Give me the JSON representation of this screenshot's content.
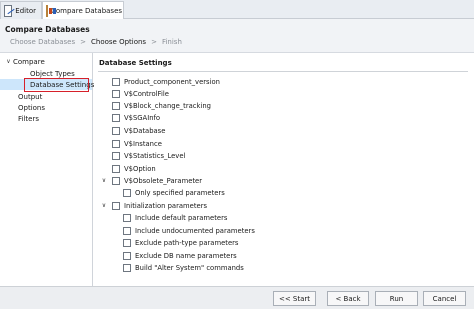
{
  "tabs": [
    {
      "label": "Editor",
      "icon": "editor-icon"
    },
    {
      "label": "Compare Databases",
      "icon": "compare-databases-icon"
    }
  ],
  "header": {
    "title": "Compare Databases",
    "breadcrumb": {
      "step1": "Choose Databases",
      "sep1": ">",
      "step2": "Choose Options",
      "sep2": ">",
      "step3": "Finish"
    }
  },
  "tree": {
    "compare": "Compare",
    "object_types": "Object Types",
    "database_settings": "Database Settings",
    "output": "Output",
    "options": "Options",
    "filters": "Filters",
    "selected": "Database Settings"
  },
  "section": {
    "title": "Database Settings"
  },
  "settings": [
    {
      "label": "Product_component_version",
      "checked": false
    },
    {
      "label": "V$ControlFile",
      "checked": false
    },
    {
      "label": "V$Block_change_tracking",
      "checked": false
    },
    {
      "label": "V$SGAInfo",
      "checked": false
    },
    {
      "label": "V$Database",
      "checked": false
    },
    {
      "label": "V$Instance",
      "checked": false
    },
    {
      "label": "V$Statistics_Level",
      "checked": false
    },
    {
      "label": "V$Option",
      "checked": false
    },
    {
      "label": "V$Obsolete_Parameter",
      "checked": false,
      "expanded": true
    },
    {
      "label": "Only specified parameters",
      "checked": false
    },
    {
      "label": "Initialization parameters",
      "checked": false,
      "expanded": true
    },
    {
      "label": "Include default parameters",
      "checked": false
    },
    {
      "label": "Include undocumented parameters",
      "checked": false
    },
    {
      "label": "Exclude path-type parameters",
      "checked": false
    },
    {
      "label": "Exclude DB name parameters",
      "checked": false
    },
    {
      "label": "Build \"Alter System\" commands",
      "checked": false
    }
  ],
  "footer": {
    "start": "<< Start",
    "back": "< Back",
    "run": "Run",
    "cancel": "Cancel"
  }
}
